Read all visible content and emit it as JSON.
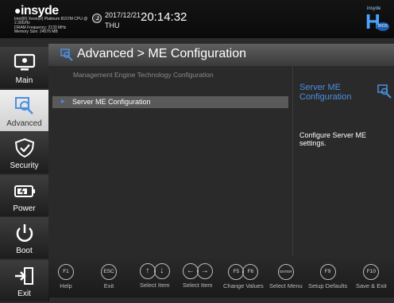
{
  "header": {
    "logo": "insyde",
    "sysinfo": [
      "Intel(R) Xeon(R) Platinum 8157M CPU @",
      "2.30GHz",
      "DRAM Frequency: 2133 MHz",
      "Memory Size: 24576 MB"
    ],
    "date": "2017/12/21",
    "day": "THU",
    "time": "20:14:32",
    "brand_small": "insyde",
    "brand_big": "H",
    "brand_bios": "BIOS"
  },
  "sidebar": {
    "items": [
      {
        "label": "Main",
        "icon": "monitor-icon",
        "active": false
      },
      {
        "label": "Advanced",
        "icon": "advanced-icon",
        "active": true
      },
      {
        "label": "Security",
        "icon": "shield-icon",
        "active": false
      },
      {
        "label": "Power",
        "icon": "battery-icon",
        "active": false
      },
      {
        "label": "Boot",
        "icon": "power-icon",
        "active": false
      },
      {
        "label": "Exit",
        "icon": "exit-icon",
        "active": false
      }
    ]
  },
  "main": {
    "title": "Advanced > ME Configuration",
    "caption": "Management Engine Technology Configuration",
    "menu": [
      {
        "label": "Server ME Configuration",
        "selected": true
      }
    ]
  },
  "help": {
    "title_line1": "Server ME",
    "title_line2": "Configuration",
    "desc_line1": "Configure Server ME",
    "desc_line2": "settings."
  },
  "keys": [
    {
      "keys": [
        "F1"
      ],
      "label": "Help"
    },
    {
      "keys": [
        "ESC"
      ],
      "label": "Exit"
    },
    {
      "keys": [
        "↑",
        "↓"
      ],
      "label": "Select Item"
    },
    {
      "keys": [
        "←",
        "→"
      ],
      "label": "Select Item"
    },
    {
      "keys": [
        "F5",
        "F6"
      ],
      "label": "Change Values"
    },
    {
      "keys": [
        "ENTER"
      ],
      "label": "Select Menu"
    },
    {
      "keys": [
        "F9"
      ],
      "label": "Setup Defaults"
    },
    {
      "keys": [
        "F10"
      ],
      "label": "Save & Exit"
    }
  ],
  "colors": {
    "accent": "#4a90e2",
    "panel": "#2a2a2a",
    "selected_row": "#5a5a5a"
  }
}
